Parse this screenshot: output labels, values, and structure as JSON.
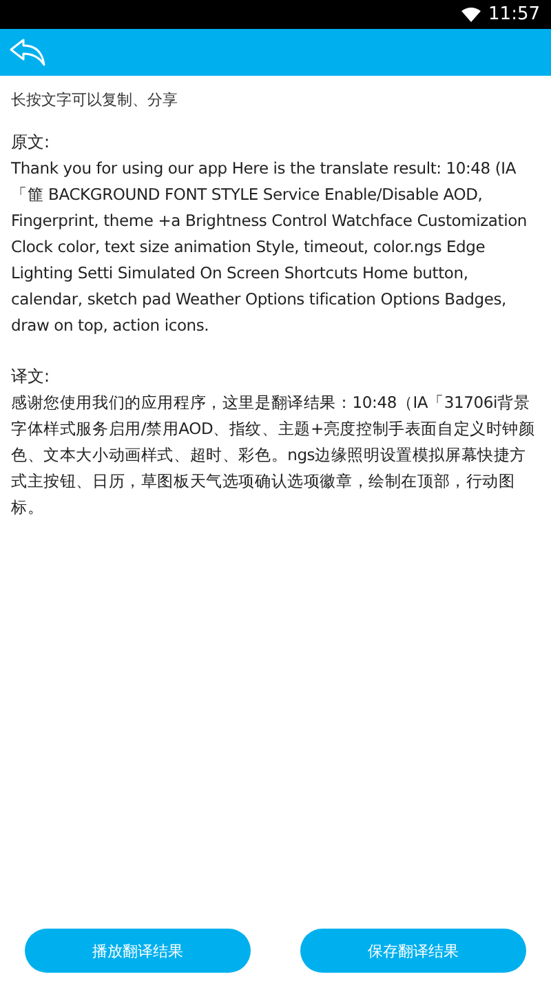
{
  "status_bar": {
    "time": "11:57"
  },
  "hint": "长按文字可以复制、分享",
  "sections": [
    {
      "label": "原文:",
      "text": "Thank you for using our app Here is the translate result: 10:48 (IA「篚 BACKGROUND FONT STYLE Service Enable/Disable AOD, Fingerprint, theme +a Brightness Control Watchface Customization Clock color, text size animation Style, timeout, color.ngs Edge Lighting Setti Simulated On Screen Shortcuts Home button, calendar, sketch pad Weather Options tification Options Badges, draw on top, action icons."
    },
    {
      "label": "译文:",
      "text": "感谢您使用我们的应用程序，这里是翻译结果：10:48（IA「31706i背景字体样式服务启用/禁用AOD、指纹、主题+亮度控制手表面自定义时钟颜色、文本大小动画样式、超时、彩色。ngs边缘照明设置模拟屏幕快捷方式主按钮、日历，草图板天气选项确认选项徽章，绘制在顶部，行动图标。"
    }
  ],
  "buttons": [
    "播放翻译结果",
    "保存翻译结果"
  ]
}
